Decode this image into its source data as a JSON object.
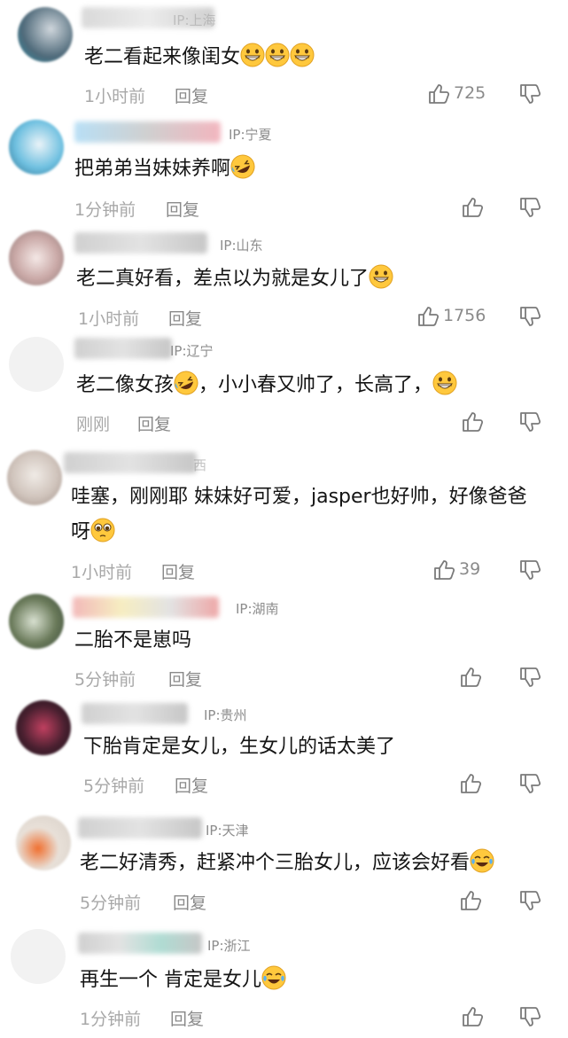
{
  "colors": {
    "text": "#141414",
    "meta": "#a8a8a8",
    "ip": "#8c8c8c",
    "emoji": "#ffc83d"
  },
  "comments": [
    {
      "name": "爱小孩",
      "ip": "IP:上海",
      "text": "老二看起来像闺女",
      "emoji": [
        "grin",
        "grin",
        "grin"
      ],
      "time": "1小时前",
      "reply": "回复",
      "likes": "725"
    },
    {
      "name": "",
      "ip": "IP:宁夏",
      "text": "把弟弟当妹妹养啊",
      "emoji": [
        "rofl"
      ],
      "time": "1分钟前",
      "reply": "回复",
      "likes": ""
    },
    {
      "name": "美",
      "ip": "IP:山东",
      "text": "老二真好看，差点以为就是女儿了",
      "emoji": [
        "grin"
      ],
      "time": "1小时前",
      "reply": "回复",
      "likes": "1756"
    },
    {
      "name": "",
      "ip": "IP:辽宁",
      "text": "老二像女孩",
      "text2": "，小小春又帅了，长高了，",
      "emoji": [
        "rofl"
      ],
      "emoji2": [
        "grin"
      ],
      "time": "刚刚",
      "reply": "回复",
      "likes": ""
    },
    {
      "name": "西",
      "ip": "",
      "text": "哇塞，刚刚耶  妹妹好可爱，jasper也好帅，好像爸爸呀",
      "emoji": [
        "plead"
      ],
      "time": "1小时前",
      "reply": "回复",
      "likes": "39"
    },
    {
      "name": "",
      "ip": "IP:湖南",
      "text": "二胎不是崽吗",
      "emoji": [],
      "time": "5分钟前",
      "reply": "回复",
      "likes": ""
    },
    {
      "name": "果了",
      "ip": "IP:贵州",
      "text": "下胎肯定是女儿，生女儿的话太美了",
      "emoji": [],
      "time": "5分钟前",
      "reply": "回复",
      "likes": ""
    },
    {
      "name": "",
      "ip": "IP:天津",
      "text": "老二好清秀，赶紧冲个三胎女儿，应该会好看",
      "emoji": [
        "joy"
      ],
      "time": "5分钟前",
      "reply": "回复",
      "likes": ""
    },
    {
      "name": "",
      "ip": "IP:浙江",
      "text": "再生一个 肯定是女儿",
      "emoji": [
        "joy"
      ],
      "time": "1分钟前",
      "reply": "回复",
      "likes": ""
    }
  ]
}
